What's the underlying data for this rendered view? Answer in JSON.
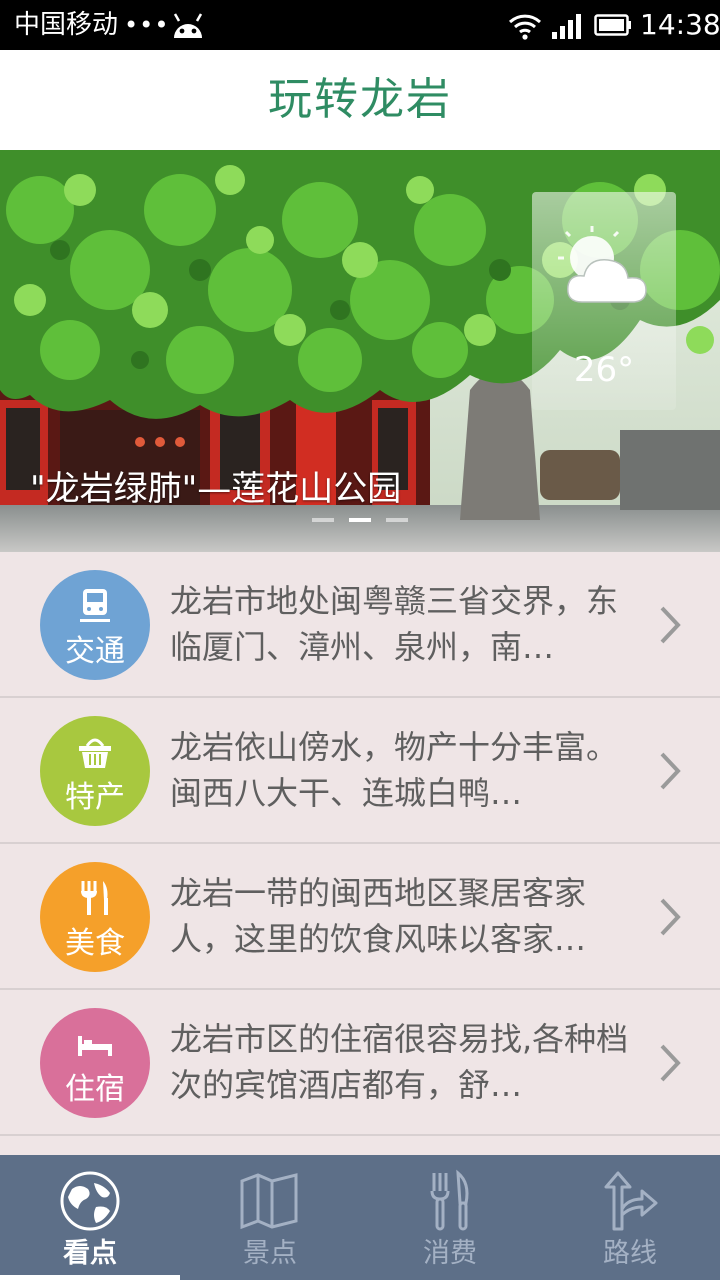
{
  "status_bar": {
    "carrier": "中国移动",
    "dots": "•••",
    "time": "14:38"
  },
  "header": {
    "title": "玩转龙岩"
  },
  "banner": {
    "caption": "\"龙岩绿肺\"—莲花山公园",
    "weather_temp": "26°",
    "weather_icon": "partly-cloudy-icon",
    "page_count": 3,
    "active_page": 2
  },
  "categories": [
    {
      "label": "交通",
      "icon": "train-icon",
      "color": "#6fa3d4",
      "text": "龙岩市地处闽粤赣三省交界，东临厦门、漳州、泉州，南…"
    },
    {
      "label": "特产",
      "icon": "basket-icon",
      "color": "#a8c83f",
      "text": "龙岩依山傍水，物产十分丰富。闽西八大干、连城白鸭…"
    },
    {
      "label": "美食",
      "icon": "fork-knife-icon",
      "color": "#f5a02a",
      "text": "龙岩一带的闽西地区聚居客家人，这里的饮食风味以客家…"
    },
    {
      "label": "住宿",
      "icon": "bed-icon",
      "color": "#d9709a",
      "text": "龙岩市区的住宿很容易找,各种档次的宾馆酒店都有，舒…"
    }
  ],
  "bottom_nav": {
    "items": [
      {
        "label": "看点",
        "icon": "globe-icon",
        "active": true
      },
      {
        "label": "景点",
        "icon": "map-icon",
        "active": false
      },
      {
        "label": "消费",
        "icon": "utensils-icon",
        "active": false
      },
      {
        "label": "路线",
        "icon": "route-sign-icon",
        "active": false
      }
    ]
  },
  "colors": {
    "title": "#2f8c63",
    "nav_background": "#5d6f88",
    "list_background": "#efe5e6"
  }
}
